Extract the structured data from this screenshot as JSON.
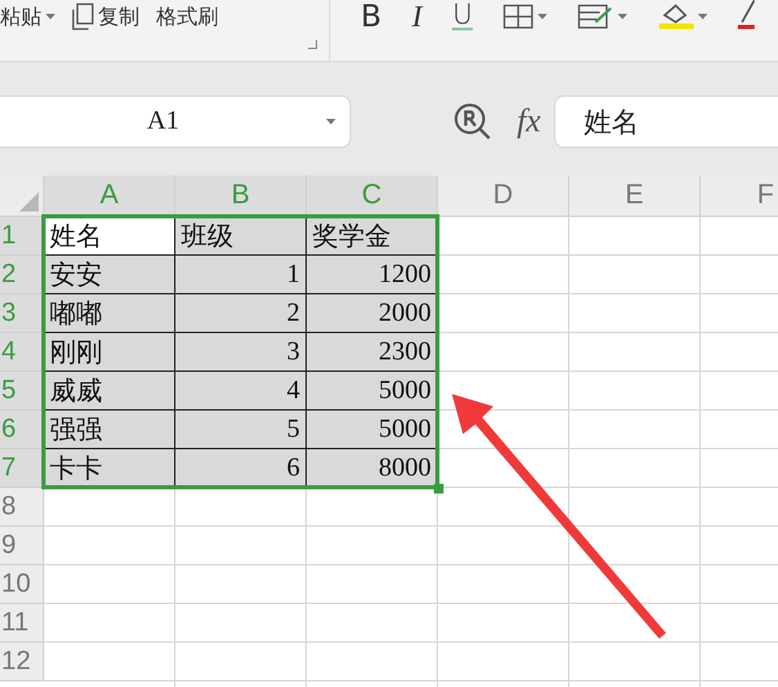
{
  "toolbar": {
    "paste": "粘贴",
    "copy": "复制",
    "format_painter": "格式刷",
    "bold": "B",
    "italic": "I",
    "underline": "U"
  },
  "formula_bar": {
    "name_box": "A1",
    "function_label": "fx",
    "formula": "姓名"
  },
  "columns": [
    {
      "label": "A",
      "selected": true
    },
    {
      "label": "B",
      "selected": true
    },
    {
      "label": "C",
      "selected": true
    },
    {
      "label": "D",
      "selected": false
    },
    {
      "label": "E",
      "selected": false
    },
    {
      "label": "F",
      "selected": false
    }
  ],
  "rows": [
    {
      "label": "1",
      "selected": true,
      "cells": [
        {
          "text": "姓名",
          "kind": "text",
          "selected": true,
          "active": true
        },
        {
          "text": "班级",
          "kind": "text",
          "selected": true,
          "active": false
        },
        {
          "text": "奖学金",
          "kind": "text",
          "selected": true,
          "active": false
        }
      ]
    },
    {
      "label": "2",
      "selected": true,
      "cells": [
        {
          "text": "安安",
          "kind": "text",
          "selected": true,
          "active": false
        },
        {
          "text": "1",
          "kind": "number",
          "selected": true,
          "active": false
        },
        {
          "text": "1200",
          "kind": "number",
          "selected": true,
          "active": false
        }
      ]
    },
    {
      "label": "3",
      "selected": true,
      "cells": [
        {
          "text": "嘟嘟",
          "kind": "text",
          "selected": true,
          "active": false
        },
        {
          "text": "2",
          "kind": "number",
          "selected": true,
          "active": false
        },
        {
          "text": "2000",
          "kind": "number",
          "selected": true,
          "active": false
        }
      ]
    },
    {
      "label": "4",
      "selected": true,
      "cells": [
        {
          "text": "刚刚",
          "kind": "text",
          "selected": true,
          "active": false
        },
        {
          "text": "3",
          "kind": "number",
          "selected": true,
          "active": false
        },
        {
          "text": "2300",
          "kind": "number",
          "selected": true,
          "active": false
        }
      ]
    },
    {
      "label": "5",
      "selected": true,
      "cells": [
        {
          "text": "威威",
          "kind": "text",
          "selected": true,
          "active": false
        },
        {
          "text": "4",
          "kind": "number",
          "selected": true,
          "active": false
        },
        {
          "text": "5000",
          "kind": "number",
          "selected": true,
          "active": false
        }
      ]
    },
    {
      "label": "6",
      "selected": true,
      "cells": [
        {
          "text": "强强",
          "kind": "text",
          "selected": true,
          "active": false
        },
        {
          "text": "5",
          "kind": "number",
          "selected": true,
          "active": false
        },
        {
          "text": "5000",
          "kind": "number",
          "selected": true,
          "active": false
        }
      ]
    },
    {
      "label": "7",
      "selected": true,
      "cells": [
        {
          "text": "卡卡",
          "kind": "text",
          "selected": true,
          "active": false
        },
        {
          "text": "6",
          "kind": "number",
          "selected": true,
          "active": false
        },
        {
          "text": "8000",
          "kind": "number",
          "selected": true,
          "active": false
        }
      ]
    },
    {
      "label": "8",
      "selected": false
    },
    {
      "label": "9",
      "selected": false
    },
    {
      "label": "10",
      "selected": false
    },
    {
      "label": "11",
      "selected": false
    },
    {
      "label": "12",
      "selected": false
    }
  ]
}
